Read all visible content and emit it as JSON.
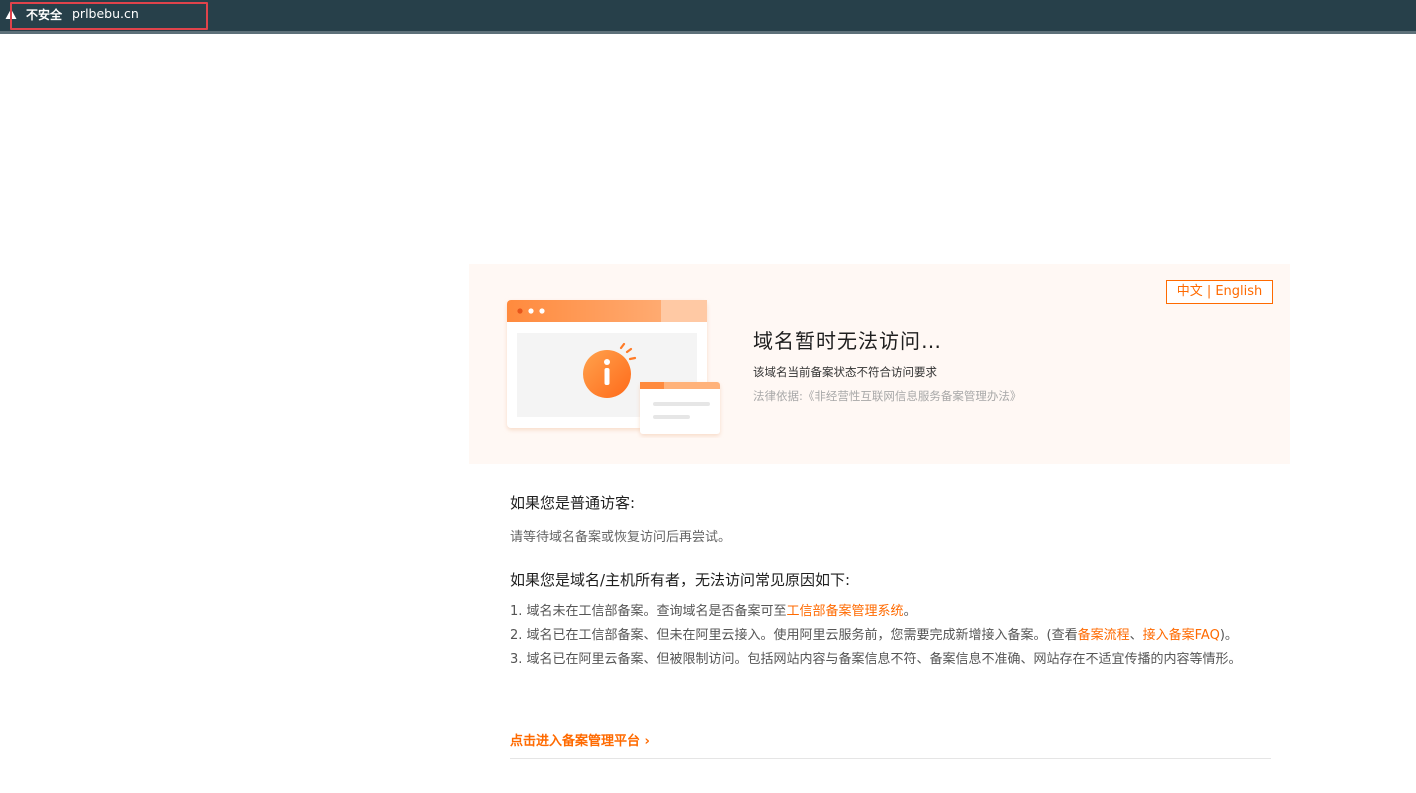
{
  "browser": {
    "security_label": "不安全",
    "url": "prlbebu.cn",
    "warning_color": "#e0434b"
  },
  "banner": {
    "lang_toggle": "中文 | English",
    "title": "域名暂时无法访问…",
    "subtitle": "该域名当前备案状态不符合访问要求",
    "legal_basis": "法律依据:《非经营性互联网信息服务备案管理办法》",
    "icon": "info-icon"
  },
  "visitor": {
    "heading": "如果您是普通访客:",
    "text": "请等待域名备案或恢复访问后再尝试。"
  },
  "owner": {
    "heading": "如果您是域名/主机所有者，无法访问常见原因如下:",
    "item1_text": "1. 域名未在工信部备案。查询域名是否备案可至",
    "item1_link": "工信部备案管理系统",
    "item1_end": "。",
    "item2_text": "2. 域名已在工信部备案、但未在阿里云接入。使用阿里云服务前，您需要完成新增接入备案。(查看",
    "item2_link1": "备案流程",
    "item2_sep": "、",
    "item2_link2": "接入备案FAQ",
    "item2_end": ")。",
    "item3_text": "3. 域名已在阿里云备案、但被限制访问。包括网站内容与备案信息不符、备案信息不准确、网站存在不适宜传播的内容等情形。"
  },
  "cta": {
    "label": "点击进入备案管理平台 ›"
  },
  "colors": {
    "accent": "#ff6a00",
    "topbar": "#27404a",
    "banner_bg": "#fff8f4"
  }
}
